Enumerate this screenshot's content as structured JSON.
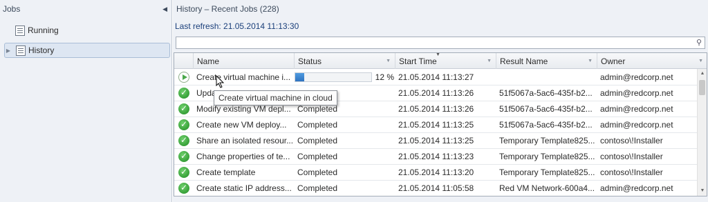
{
  "nav": {
    "header": "Jobs",
    "items": [
      {
        "label": "Running",
        "icon": "document-list-icon"
      },
      {
        "label": "History",
        "icon": "document-list-icon"
      }
    ]
  },
  "main": {
    "title": "History – Recent Jobs (228)",
    "last_refresh": "Last refresh: 21.05.2014 11:13:30",
    "search_placeholder": "",
    "columns": [
      "Name",
      "Status",
      "Start Time",
      "Result Name",
      "Owner"
    ],
    "sorted_column": "Start Time",
    "rows": [
      {
        "icon": "running",
        "name": "Create virtual machine i...",
        "status": "",
        "progress": 0.12,
        "progress_text": "12 %",
        "start": "21.05.2014 11:13:27",
        "result": "",
        "owner": "admin@redcorp.net"
      },
      {
        "icon": "completed",
        "name": "Upda",
        "status": "",
        "start": "21.05.2014 11:13:26",
        "result": "51f5067a-5ac6-435f-b2...",
        "owner": "admin@redcorp.net"
      },
      {
        "icon": "completed",
        "name": "Modify existing VM depl...",
        "status": "Completed",
        "start": "21.05.2014 11:13:26",
        "result": "51f5067a-5ac6-435f-b2...",
        "owner": "admin@redcorp.net"
      },
      {
        "icon": "completed",
        "name": "Create new VM deploy...",
        "status": "Completed",
        "start": "21.05.2014 11:13:25",
        "result": "51f5067a-5ac6-435f-b2...",
        "owner": "admin@redcorp.net"
      },
      {
        "icon": "completed",
        "name": "Share an isolated resour...",
        "status": "Completed",
        "start": "21.05.2014 11:13:25",
        "result": "Temporary Template825...",
        "owner": "contoso\\!Installer"
      },
      {
        "icon": "completed",
        "name": "Change properties of te...",
        "status": "Completed",
        "start": "21.05.2014 11:13:23",
        "result": "Temporary Template825...",
        "owner": "contoso\\!Installer"
      },
      {
        "icon": "completed",
        "name": "Create template",
        "status": "Completed",
        "start": "21.05.2014 11:13:20",
        "result": "Temporary Template825...",
        "owner": "contoso\\!Installer"
      },
      {
        "icon": "completed",
        "name": "Create static IP address...",
        "status": "Completed",
        "start": "21.05.2014 11:05:58",
        "result": "Red VM Network-600a4...",
        "owner": "admin@redcorp.net"
      }
    ]
  },
  "tooltip": "Create virtual machine in cloud",
  "colors": {
    "accent": "#2f73c0",
    "success": "#1f8b22",
    "link": "#1a3f7a"
  }
}
